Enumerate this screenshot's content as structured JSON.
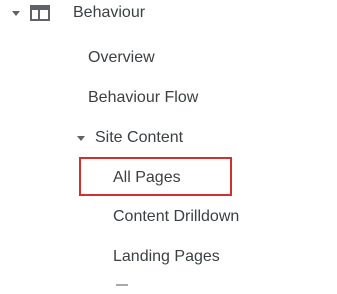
{
  "nav": {
    "section": {
      "label": "Behaviour",
      "expanded": true,
      "icon": "browser-window-icon"
    },
    "items": [
      {
        "label": "Overview"
      },
      {
        "label": "Behaviour Flow"
      }
    ],
    "subsection": {
      "label": "Site Content",
      "expanded": true,
      "items": [
        {
          "label": "All Pages",
          "selected": true
        },
        {
          "label": "Content Drilldown"
        },
        {
          "label": "Landing Pages"
        }
      ]
    }
  },
  "colors": {
    "text": "#3c4043",
    "icon": "#5f6368",
    "highlight_border": "#d32f2f",
    "background": "#ffffff"
  }
}
